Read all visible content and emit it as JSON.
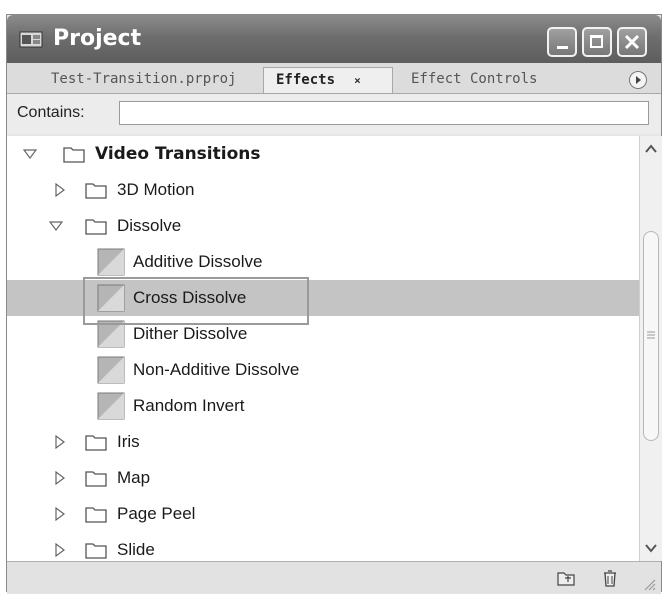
{
  "window": {
    "title": "Project",
    "controls": [
      "minimize",
      "maximize",
      "close"
    ]
  },
  "tabs": [
    {
      "label": "Test-Transition.prproj",
      "active": false
    },
    {
      "label": "Effects",
      "active": true,
      "close_glyph": "×"
    },
    {
      "label": "Effect Controls",
      "active": false
    }
  ],
  "search": {
    "label": "Contains:",
    "value": "",
    "placeholder": ""
  },
  "tree": [
    {
      "label": "Video Transitions",
      "type": "folder",
      "expanded": true,
      "bold": true
    },
    {
      "label": "3D Motion",
      "type": "folder",
      "expanded": false
    },
    {
      "label": "Dissolve",
      "type": "folder",
      "expanded": true
    },
    {
      "label": "Additive Dissolve",
      "type": "effect"
    },
    {
      "label": "Cross Dissolve",
      "type": "effect",
      "selected": true
    },
    {
      "label": "Dither Dissolve",
      "type": "effect"
    },
    {
      "label": "Non-Additive Dissolve",
      "type": "effect"
    },
    {
      "label": "Random Invert",
      "type": "effect"
    },
    {
      "label": "Iris",
      "type": "folder",
      "expanded": false
    },
    {
      "label": "Map",
      "type": "folder",
      "expanded": false
    },
    {
      "label": "Page Peel",
      "type": "folder",
      "expanded": false
    },
    {
      "label": "Slide",
      "type": "folder",
      "expanded": false
    }
  ],
  "statusbar": {
    "icons": [
      "new-bin-icon",
      "trash-icon",
      "resize-grip-icon"
    ]
  },
  "colors": {
    "titlebar": "#6e6e6e",
    "selection": "#c4c4c4",
    "highlight_box": "#9a9a9a"
  }
}
